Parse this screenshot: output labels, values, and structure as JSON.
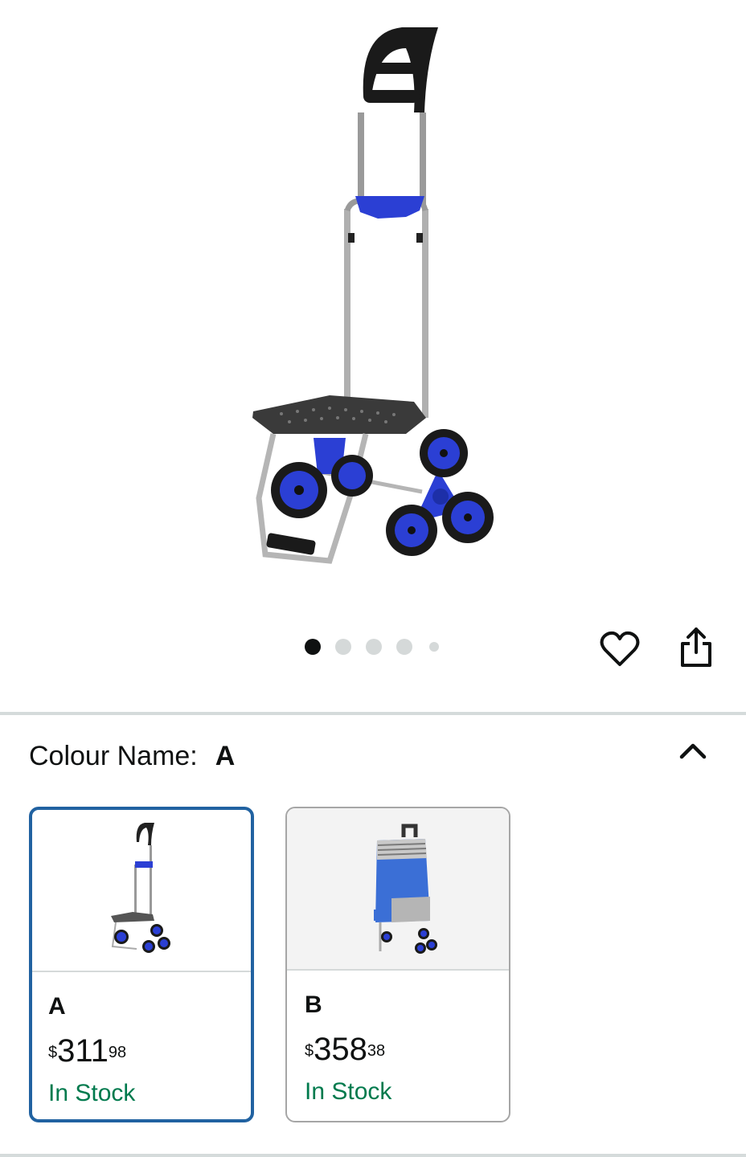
{
  "product": {
    "image_alt": "stair climbing trolley with folding seat",
    "carousel": {
      "count": 5,
      "active_index": 0
    }
  },
  "actions": {
    "wishlist_icon": "heart-outline-icon",
    "share_icon": "share-icon"
  },
  "variant_selector": {
    "label": "Colour Name:",
    "selected_value": "A",
    "collapse_icon": "chevron-up-icon",
    "options": [
      {
        "name": "A",
        "currency": "$",
        "price_whole": "311",
        "price_fraction": "98",
        "stock": "In Stock",
        "selected": true
      },
      {
        "name": "B",
        "currency": "$",
        "price_whole": "358",
        "price_fraction": "38",
        "stock": "In Stock",
        "selected": false
      }
    ]
  },
  "colors": {
    "accent_blue": "#2162a1",
    "stock_green": "#007a4d",
    "divider": "#d5dbdb",
    "product_blue": "#2b3fd4"
  }
}
